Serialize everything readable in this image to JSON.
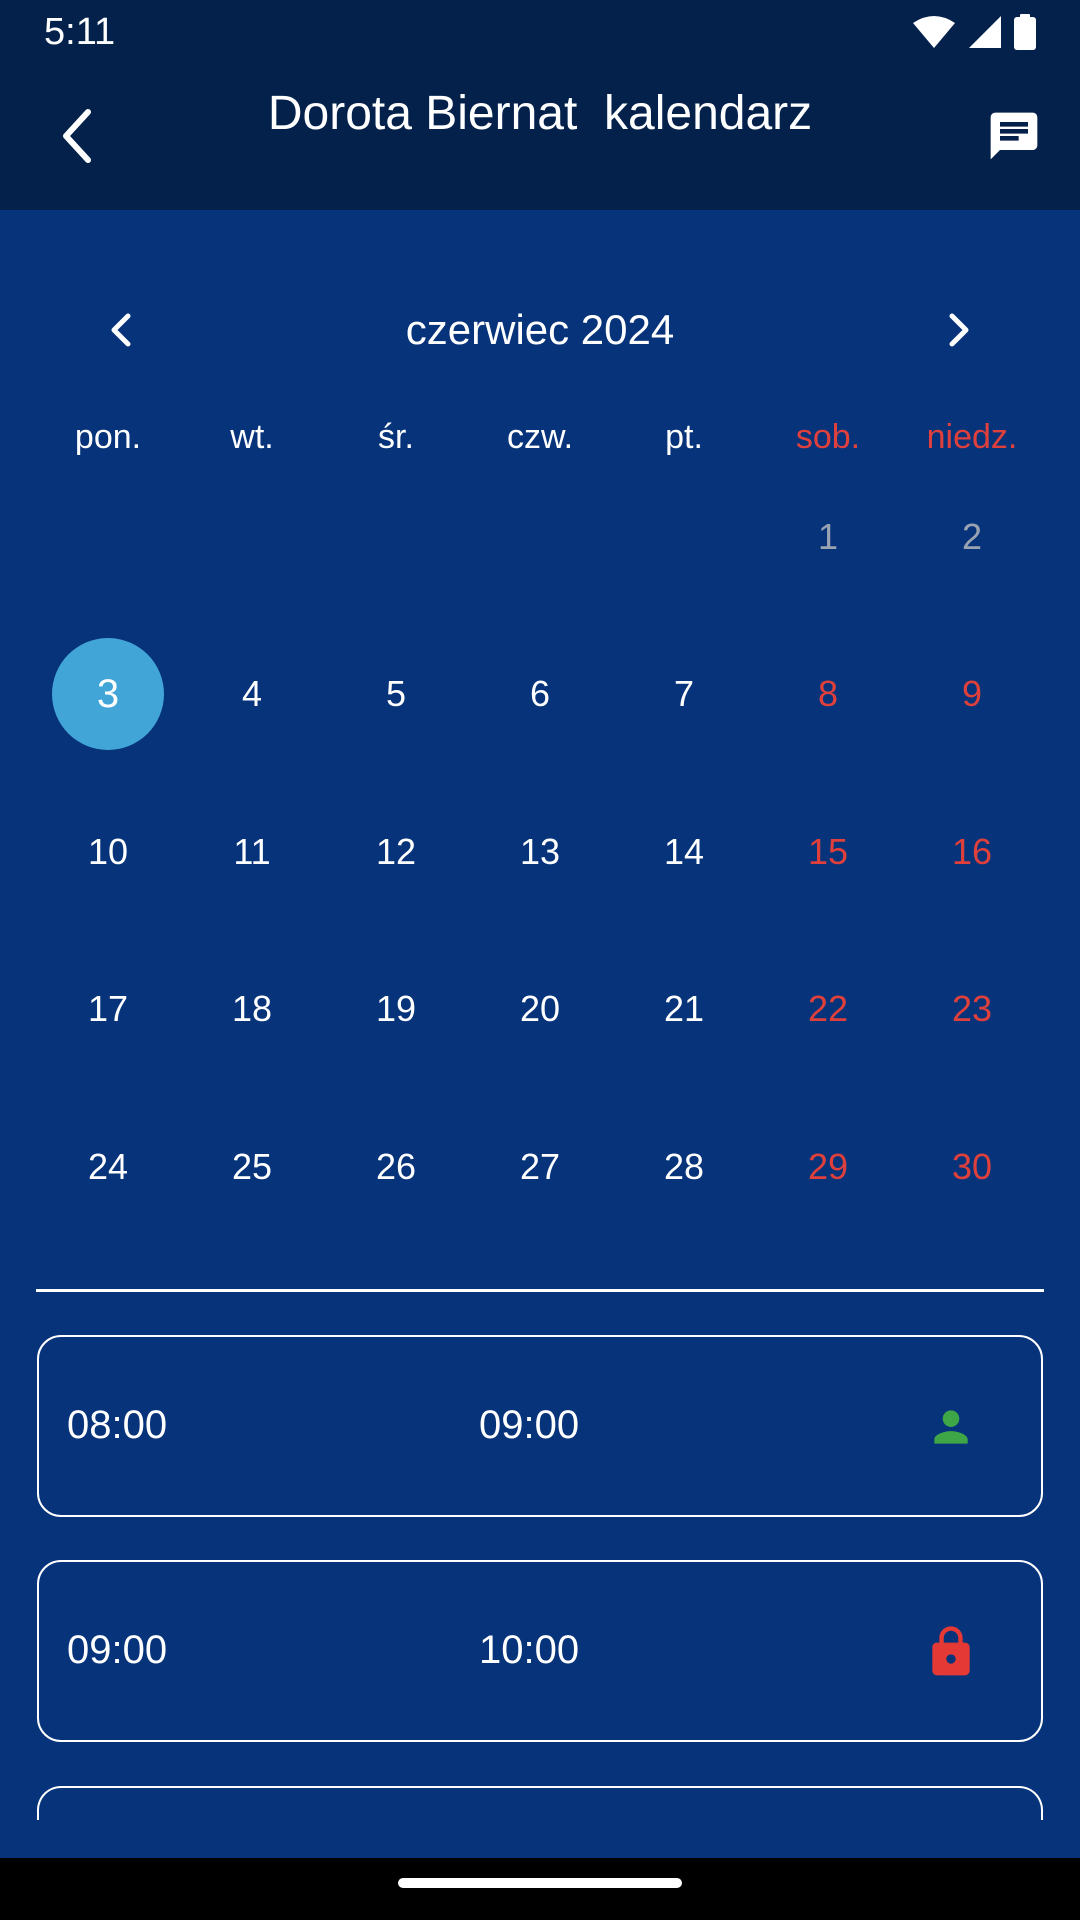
{
  "status_bar": {
    "time": "5:11",
    "icons": [
      "wifi-icon",
      "signal-icon",
      "battery-icon"
    ]
  },
  "app_bar": {
    "title": "Dorota Biernat  kalendarz",
    "back_icon": "chevron-left-icon",
    "action_icon": "chat-icon"
  },
  "calendar": {
    "month_label": "czerwiec 2024",
    "weekdays": [
      "pon.",
      "wt.",
      "śr.",
      "czw.",
      "pt.",
      "sob.",
      "niedz."
    ],
    "days": [
      "",
      "",
      "",
      "",
      "",
      "1",
      "2",
      "3",
      "4",
      "5",
      "6",
      "7",
      "8",
      "9",
      "10",
      "11",
      "12",
      "13",
      "14",
      "15",
      "16",
      "17",
      "18",
      "19",
      "20",
      "21",
      "22",
      "23",
      "24",
      "25",
      "26",
      "27",
      "28",
      "29",
      "30"
    ],
    "selected_day": "3",
    "weekend_color": "#e0403c",
    "selected_color": "#42a5d8"
  },
  "slots": [
    {
      "start": "08:00",
      "end": "09:00",
      "icon": "person-icon",
      "icon_color": "#3ea646"
    },
    {
      "start": "09:00",
      "end": "10:00",
      "icon": "lock-icon",
      "icon_color": "#e53935"
    }
  ],
  "colors": {
    "background": "#06337a",
    "app_bar": "#04214b"
  }
}
